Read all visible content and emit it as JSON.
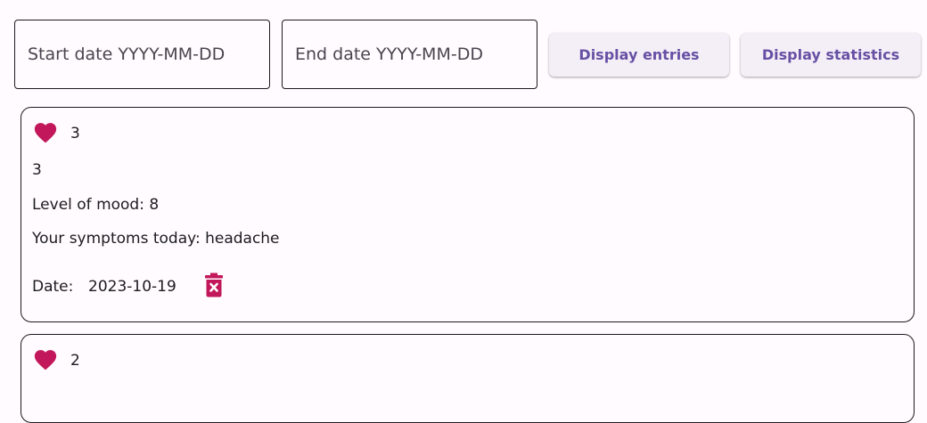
{
  "toolbar": {
    "start_date": {
      "placeholder": "Start date YYYY-MM-DD",
      "value": ""
    },
    "end_date": {
      "placeholder": "End date YYYY-MM-DD",
      "value": ""
    },
    "display_entries_label": "Display entries",
    "display_statistics_label": "Display statistics"
  },
  "colors": {
    "accent": "#6750a4",
    "heart": "#c2185b",
    "trash": "#c2185b",
    "button_bg": "#f4eff7",
    "background": "#fffbfe"
  },
  "entries": [
    {
      "icon": "heart-icon",
      "title": "3",
      "subtitle": "3",
      "mood_text": "Level of mood: 8",
      "symptoms_text": "Your symptoms today: headache",
      "date_label": "Date:",
      "date_value": "2023-10-19",
      "delete_icon": "trash-x-icon"
    },
    {
      "icon": "heart-icon",
      "title": "2"
    }
  ]
}
